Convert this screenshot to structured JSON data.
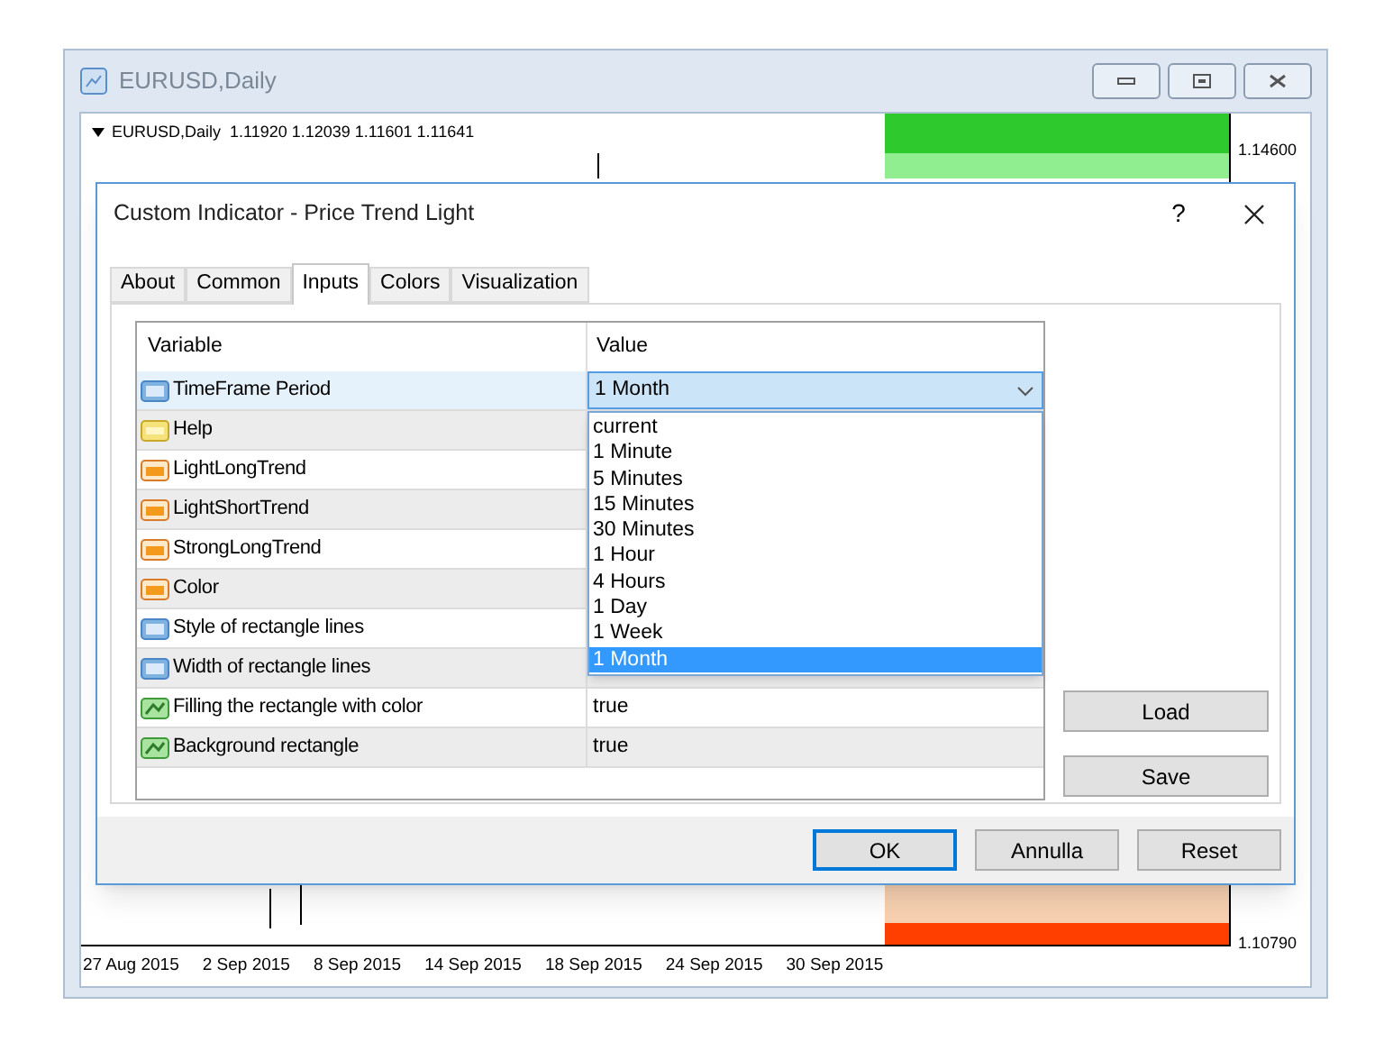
{
  "window": {
    "title": "EURUSD,Daily"
  },
  "chart": {
    "header": "EURUSD,Daily  1.11920 1.12039 1.11601 1.11641",
    "price_labels": [
      "1.14600",
      "1.10790"
    ],
    "date_labels": [
      "27 Aug 2015",
      "2 Sep 2015",
      "8 Sep 2015",
      "14 Sep 2015",
      "18 Sep 2015",
      "24 Sep 2015",
      "30 Sep 2015"
    ]
  },
  "dialog": {
    "title": "Custom Indicator - Price Trend Light",
    "help": "?",
    "tabs": [
      {
        "label": "About",
        "selected": false
      },
      {
        "label": "Common",
        "selected": false
      },
      {
        "label": "Inputs",
        "selected": true
      },
      {
        "label": "Colors",
        "selected": false
      },
      {
        "label": "Visualization",
        "selected": false
      }
    ],
    "table": {
      "columns": [
        "Variable",
        "Value"
      ],
      "rows": [
        {
          "kind": "int",
          "variable": "TimeFrame Period",
          "value": "1 Month",
          "selected": true
        },
        {
          "kind": "string",
          "variable": "Help",
          "selected": false
        },
        {
          "kind": "color",
          "variable": "LightLongTrend",
          "selected": false
        },
        {
          "kind": "color",
          "variable": "LightShortTrend",
          "selected": false
        },
        {
          "kind": "color",
          "variable": "StrongLongTrend",
          "selected": false
        },
        {
          "kind": "color",
          "variable": "Color",
          "selected": false
        },
        {
          "kind": "int",
          "variable": "Style of rectangle lines",
          "selected": false
        },
        {
          "kind": "int",
          "variable": "Width of rectangle lines",
          "selected": false
        },
        {
          "kind": "bool",
          "variable": "Filling the rectangle with color",
          "value": "true",
          "selected": false
        },
        {
          "kind": "bool",
          "variable": "Background rectangle",
          "value": "true",
          "selected": false
        }
      ]
    },
    "dropdown": {
      "options": [
        {
          "label": "current",
          "selected": false
        },
        {
          "label": "1 Minute",
          "selected": false
        },
        {
          "label": "5 Minutes",
          "selected": false
        },
        {
          "label": "15 Minutes",
          "selected": false
        },
        {
          "label": "30 Minutes",
          "selected": false
        },
        {
          "label": "1 Hour",
          "selected": false
        },
        {
          "label": "4 Hours",
          "selected": false
        },
        {
          "label": "1 Day",
          "selected": false
        },
        {
          "label": "1 Week",
          "selected": false
        },
        {
          "label": "1 Month",
          "selected": true
        }
      ]
    },
    "side_buttons": [
      "Load",
      "Save"
    ],
    "buttons": [
      {
        "label": "OK",
        "default": true
      },
      {
        "label": "Annulla",
        "default": false
      },
      {
        "label": "Reset",
        "default": false
      }
    ]
  }
}
